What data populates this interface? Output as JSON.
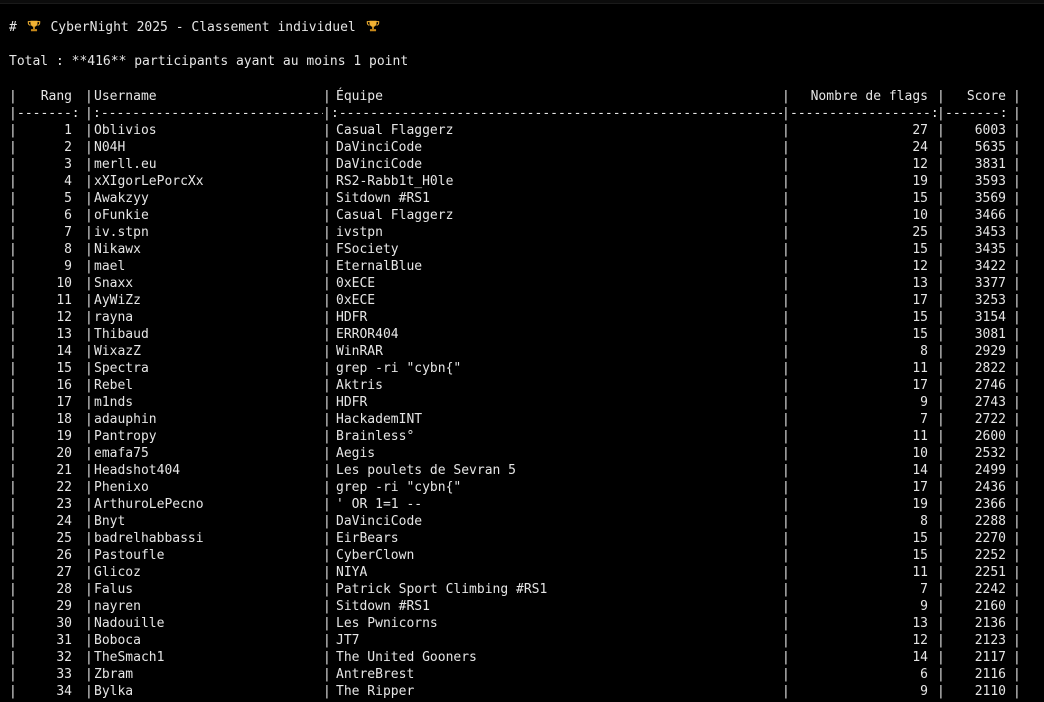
{
  "title": {
    "prefix": "# ",
    "text": "CyberNight 2025 - Classement individuel",
    "icon": "trophy-icon"
  },
  "summary": "Total : **416** participants ayant au moins 1 point",
  "table": {
    "headers": {
      "rank": "Rang",
      "username": "Username",
      "team": "Équipe",
      "flags": "Nombre de flags",
      "score": "Score"
    },
    "separator": {
      "rank": "-------:",
      "username": ":-----------------------------",
      "team": ":------------------------------------------------------------",
      "flags": "------------------:",
      "score": "-------:"
    },
    "rows": [
      {
        "rank": "1",
        "username": "Oblivios",
        "team": "Casual Flaggerz",
        "flags": "27",
        "score": "6003"
      },
      {
        "rank": "2",
        "username": "N04H",
        "team": "DaVinciCode",
        "flags": "24",
        "score": "5635"
      },
      {
        "rank": "3",
        "username": "merll.eu",
        "team": "DaVinciCode",
        "flags": "12",
        "score": "3831"
      },
      {
        "rank": "4",
        "username": "xXIgorLePorcXx",
        "team": "RS2-Rabb1t_H0le",
        "flags": "19",
        "score": "3593"
      },
      {
        "rank": "5",
        "username": "Awakzyy",
        "team": "Sitdown #RS1",
        "flags": "15",
        "score": "3569"
      },
      {
        "rank": "6",
        "username": "oFunkie",
        "team": "Casual Flaggerz",
        "flags": "10",
        "score": "3466"
      },
      {
        "rank": "7",
        "username": "iv.stpn",
        "team": "ivstpn",
        "flags": "25",
        "score": "3453"
      },
      {
        "rank": "8",
        "username": "Nikawx",
        "team": "FSociety",
        "flags": "15",
        "score": "3435"
      },
      {
        "rank": "9",
        "username": "mael",
        "team": "EternalBlue",
        "flags": "12",
        "score": "3422"
      },
      {
        "rank": "10",
        "username": "Snaxx",
        "team": "0xECE",
        "flags": "13",
        "score": "3377"
      },
      {
        "rank": "11",
        "username": "AyWiZz",
        "team": "0xECE",
        "flags": "17",
        "score": "3253"
      },
      {
        "rank": "12",
        "username": "rayna",
        "team": "HDFR",
        "flags": "15",
        "score": "3154"
      },
      {
        "rank": "13",
        "username": "Thibaud",
        "team": "ERROR404",
        "flags": "15",
        "score": "3081"
      },
      {
        "rank": "14",
        "username": "WixazZ",
        "team": "WinRAR",
        "flags": "8",
        "score": "2929"
      },
      {
        "rank": "15",
        "username": "Spectra",
        "team": "grep -ri \"cybn{\"",
        "flags": "11",
        "score": "2822"
      },
      {
        "rank": "16",
        "username": "Rebel",
        "team": "Aktris",
        "flags": "17",
        "score": "2746"
      },
      {
        "rank": "17",
        "username": "m1nds",
        "team": "HDFR",
        "flags": "9",
        "score": "2743"
      },
      {
        "rank": "18",
        "username": "adauphin",
        "team": "HackademINT",
        "flags": "7",
        "score": "2722"
      },
      {
        "rank": "19",
        "username": "Pantropy",
        "team": "Brainless°",
        "flags": "11",
        "score": "2600"
      },
      {
        "rank": "20",
        "username": "emafa75",
        "team": "Aegis",
        "flags": "10",
        "score": "2532"
      },
      {
        "rank": "21",
        "username": "Headshot404",
        "team": "Les poulets de Sevran 5",
        "flags": "14",
        "score": "2499"
      },
      {
        "rank": "22",
        "username": "Phenixo",
        "team": "grep -ri \"cybn{\"",
        "flags": "17",
        "score": "2436"
      },
      {
        "rank": "23",
        "username": "ArthuroLePecno",
        "team": "' OR 1=1 --",
        "flags": "19",
        "score": "2366"
      },
      {
        "rank": "24",
        "username": "Bnyt",
        "team": "DaVinciCode",
        "flags": "8",
        "score": "2288"
      },
      {
        "rank": "25",
        "username": "badrelhabbassi",
        "team": "EirBears",
        "flags": "15",
        "score": "2270"
      },
      {
        "rank": "26",
        "username": "Pastoufle",
        "team": "CyberClown",
        "flags": "15",
        "score": "2252"
      },
      {
        "rank": "27",
        "username": "Glicoz",
        "team": "NIYA",
        "flags": "11",
        "score": "2251"
      },
      {
        "rank": "28",
        "username": "Falus",
        "team": "Patrick Sport Climbing #RS1",
        "flags": "7",
        "score": "2242"
      },
      {
        "rank": "29",
        "username": "nayren",
        "team": "Sitdown #RS1",
        "flags": "9",
        "score": "2160"
      },
      {
        "rank": "30",
        "username": "Nadouille",
        "team": "Les Pwnicorns",
        "flags": "13",
        "score": "2136"
      },
      {
        "rank": "31",
        "username": "Boboca",
        "team": "JT7",
        "flags": "12",
        "score": "2123"
      },
      {
        "rank": "32",
        "username": "TheSmach1",
        "team": "The United Gooners",
        "flags": "14",
        "score": "2117"
      },
      {
        "rank": "33",
        "username": "Zbram",
        "team": "AntreBrest",
        "flags": "6",
        "score": "2116"
      },
      {
        "rank": "34",
        "username": "Bylka",
        "team": "The Ripper",
        "flags": "9",
        "score": "2110"
      }
    ]
  },
  "colors": {
    "background": "#000000",
    "text": "#e6e6e6",
    "trophy": "#f2b233"
  }
}
